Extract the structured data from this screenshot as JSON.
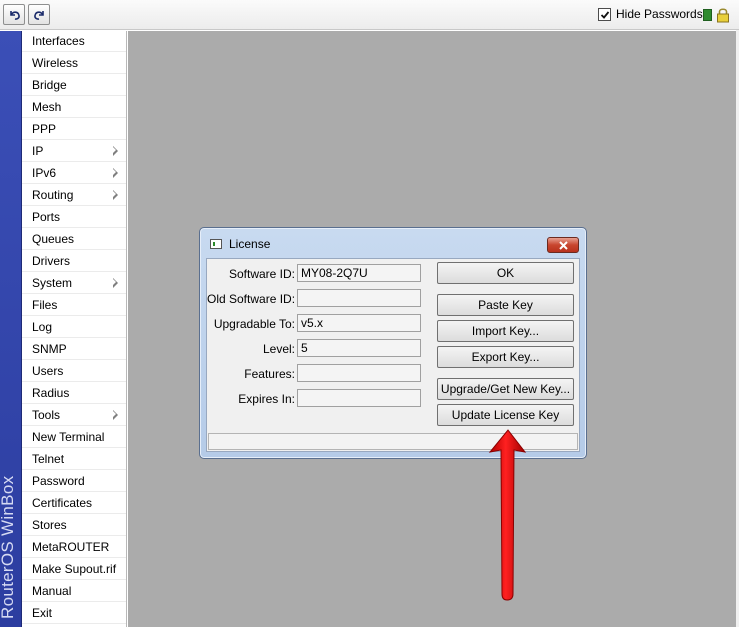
{
  "toolbar": {
    "undo_icon": "undo-icon",
    "redo_icon": "redo-icon",
    "hide_passwords_label": "Hide Passwords",
    "hide_passwords_checked": true,
    "status_color": "#2e8b2e",
    "lock_icon": "lock-icon"
  },
  "sidebar": {
    "brand": "RouterOS WinBox",
    "brand_color": "#3b4fb7",
    "items": [
      {
        "label": "Interfaces",
        "submenu": false
      },
      {
        "label": "Wireless",
        "submenu": false
      },
      {
        "label": "Bridge",
        "submenu": false
      },
      {
        "label": "Mesh",
        "submenu": false
      },
      {
        "label": "PPP",
        "submenu": false
      },
      {
        "label": "IP",
        "submenu": true
      },
      {
        "label": "IPv6",
        "submenu": true
      },
      {
        "label": "Routing",
        "submenu": true
      },
      {
        "label": "Ports",
        "submenu": false
      },
      {
        "label": "Queues",
        "submenu": false
      },
      {
        "label": "Drivers",
        "submenu": false
      },
      {
        "label": "System",
        "submenu": true
      },
      {
        "label": "Files",
        "submenu": false
      },
      {
        "label": "Log",
        "submenu": false
      },
      {
        "label": "SNMP",
        "submenu": false
      },
      {
        "label": "Users",
        "submenu": false
      },
      {
        "label": "Radius",
        "submenu": false
      },
      {
        "label": "Tools",
        "submenu": true
      },
      {
        "label": "New Terminal",
        "submenu": false
      },
      {
        "label": "Telnet",
        "submenu": false
      },
      {
        "label": "Password",
        "submenu": false
      },
      {
        "label": "Certificates",
        "submenu": false
      },
      {
        "label": "Stores",
        "submenu": false
      },
      {
        "label": "MetaROUTER",
        "submenu": false
      },
      {
        "label": "Make Supout.rif",
        "submenu": false
      },
      {
        "label": "Manual",
        "submenu": false
      },
      {
        "label": "Exit",
        "submenu": false
      }
    ]
  },
  "dialog": {
    "title": "License",
    "fields": [
      {
        "label": "Software ID:",
        "value": "MY08-2Q7U"
      },
      {
        "label": "Old Software ID:",
        "value": ""
      },
      {
        "label": "Upgradable To:",
        "value": "v5.x"
      },
      {
        "label": "Level:",
        "value": "5"
      },
      {
        "label": "Features:",
        "value": ""
      },
      {
        "label": "Expires In:",
        "value": ""
      }
    ],
    "buttons": {
      "ok": "OK",
      "paste_key": "Paste Key",
      "import_key": "Import Key...",
      "export_key": "Export Key...",
      "upgrade": "Upgrade/Get New Key...",
      "update_license": "Update License Key"
    },
    "status_text": ""
  },
  "annotation": {
    "arrow_color": "#e00000"
  }
}
